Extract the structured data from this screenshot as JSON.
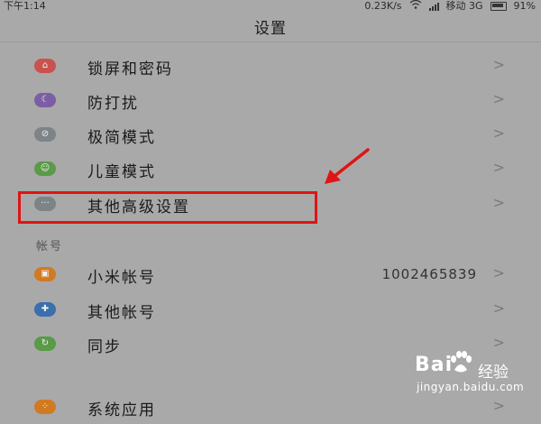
{
  "status_bar": {
    "time": "下午1:14",
    "speed": "0.23K/s",
    "carrier": "移动 3G",
    "battery": "91%"
  },
  "header": {
    "title": "设置"
  },
  "rows": [
    {
      "label": "锁屏和密码",
      "icon": "lock-icon",
      "color": "#c8534e",
      "glyph": "⌂"
    },
    {
      "label": "防打扰",
      "icon": "moon-icon",
      "color": "#7b5ea4",
      "glyph": "☾"
    },
    {
      "label": "极简模式",
      "icon": "minimal-mode-icon",
      "color": "#7d8488",
      "glyph": "⊘"
    },
    {
      "label": "儿童模式",
      "icon": "child-mode-icon",
      "color": "#5a9a48",
      "glyph": "☺"
    },
    {
      "label": "其他高级设置",
      "icon": "more-icon",
      "color": "#7d8488",
      "glyph": "···"
    }
  ],
  "accounts_section": {
    "title": "帐号",
    "rows": [
      {
        "label": "小米帐号",
        "value": "1002465839",
        "icon": "mi-account-icon",
        "color": "#d07a22",
        "glyph": "▣"
      },
      {
        "label": "其他帐号",
        "value": "",
        "icon": "other-account-icon",
        "color": "#3b6fae",
        "glyph": "✚"
      },
      {
        "label": "同步",
        "value": "",
        "icon": "sync-icon",
        "color": "#5a9a48",
        "glyph": "↻"
      }
    ]
  },
  "bottom_row": {
    "label": "系统应用",
    "icon": "system-apps-icon",
    "color": "#d07a22",
    "glyph": "⁘"
  },
  "chevron": ">",
  "watermark": {
    "brand": "Bai",
    "brand_suffix": "经验",
    "url": "jingyan.baidu.com"
  },
  "annotation_color": "#e01414"
}
